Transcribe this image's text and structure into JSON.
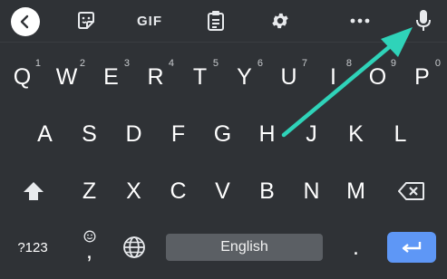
{
  "toolbar": {
    "back_icon": "chevron-left-icon",
    "sticker_icon": "sticker-icon",
    "gif_label": "GIF",
    "clipboard_icon": "clipboard-icon",
    "settings_icon": "gear-icon",
    "more_icon": "more-horizontal-icon",
    "mic_icon": "microphone-icon"
  },
  "keyboard": {
    "row1": [
      {
        "label": "Q",
        "hint": "1"
      },
      {
        "label": "W",
        "hint": "2"
      },
      {
        "label": "E",
        "hint": "3"
      },
      {
        "label": "R",
        "hint": "4"
      },
      {
        "label": "T",
        "hint": "5"
      },
      {
        "label": "Y",
        "hint": "6"
      },
      {
        "label": "U",
        "hint": "7"
      },
      {
        "label": "I",
        "hint": "8"
      },
      {
        "label": "O",
        "hint": "9"
      },
      {
        "label": "P",
        "hint": "0"
      }
    ],
    "row2": [
      {
        "label": "A"
      },
      {
        "label": "S"
      },
      {
        "label": "D"
      },
      {
        "label": "F"
      },
      {
        "label": "G"
      },
      {
        "label": "H"
      },
      {
        "label": "J"
      },
      {
        "label": "K"
      },
      {
        "label": "L"
      }
    ],
    "row3": [
      {
        "label": "Z"
      },
      {
        "label": "X"
      },
      {
        "label": "C"
      },
      {
        "label": "V"
      },
      {
        "label": "B"
      },
      {
        "label": "N"
      },
      {
        "label": "M"
      }
    ],
    "shift_icon": "shift-arrow-icon",
    "backspace_icon": "backspace-icon",
    "symbols_label": "?123",
    "comma_label": ",",
    "emoji_icon": "smiley-icon",
    "globe_icon": "globe-icon",
    "space_label": "English",
    "period_label": ".",
    "enter_icon": "enter-arrow-icon"
  },
  "colors": {
    "background": "#2f3236",
    "enter_key": "#5e97f6",
    "space_key": "#5b5f64",
    "annotation_arrow": "#2fd3b9"
  }
}
